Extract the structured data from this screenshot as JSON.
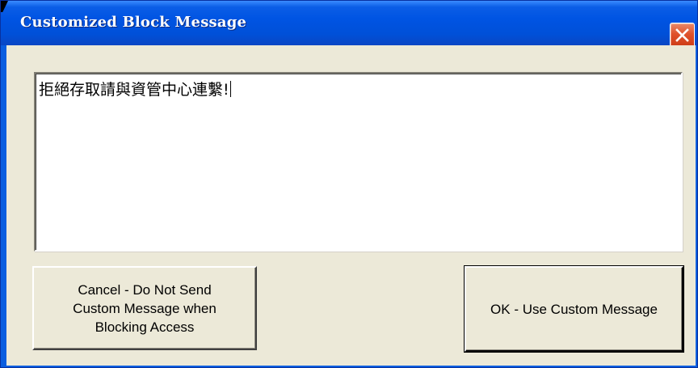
{
  "window": {
    "title": "Customized Block Message",
    "close_label": "×"
  },
  "message": {
    "value": "拒絕存取請與資管中心連繫!"
  },
  "buttons": {
    "cancel_label": "Cancel - Do Not Send Custom Message when Blocking Access",
    "ok_label": "OK - Use Custom Message"
  },
  "colors": {
    "titlebar": "#0054e3",
    "client_background": "#ece9d8",
    "close_button": "#e0522c",
    "title_text": "#ffffff"
  },
  "icons": {
    "close": "close-icon"
  }
}
